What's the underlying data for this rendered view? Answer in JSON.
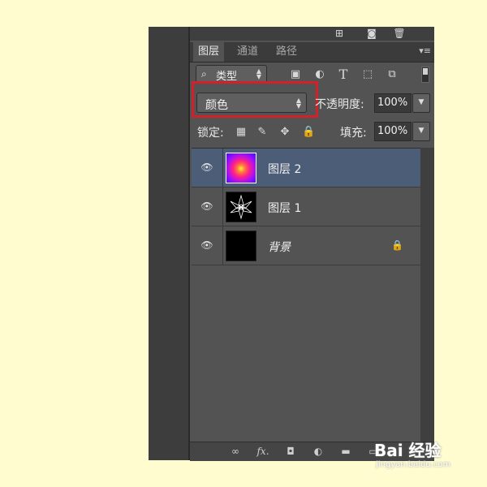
{
  "tabs": [
    {
      "label": "图层",
      "active": true
    },
    {
      "label": "通道",
      "active": false
    },
    {
      "label": "路径",
      "active": false
    }
  ],
  "filter": {
    "kind_label": "类型",
    "icons": [
      "image-filter-icon",
      "adjustment-filter-icon",
      "type-filter-icon",
      "shape-filter-icon",
      "smart-object-filter-icon"
    ]
  },
  "blend": {
    "mode": "颜色",
    "opacity_label": "不透明度:",
    "opacity_value": "100%"
  },
  "lock": {
    "label": "锁定:",
    "fill_label": "填充:",
    "fill_value": "100%"
  },
  "layers": [
    {
      "name": "图层 2",
      "selected": true,
      "visible": true,
      "thumbnail": "gradient-ring"
    },
    {
      "name": "图层 1",
      "selected": false,
      "visible": true,
      "thumbnail": "flower-outline"
    },
    {
      "name": "背景",
      "selected": false,
      "visible": true,
      "thumbnail": "black",
      "locked": true
    }
  ],
  "watermark": {
    "brand": "Bai 经验",
    "url": "jingyan.baidu.com"
  },
  "colors": {
    "highlight": "#d2212b",
    "selected_row": "#4c5d78",
    "panel": "#535353",
    "background": "#fffdd0"
  }
}
